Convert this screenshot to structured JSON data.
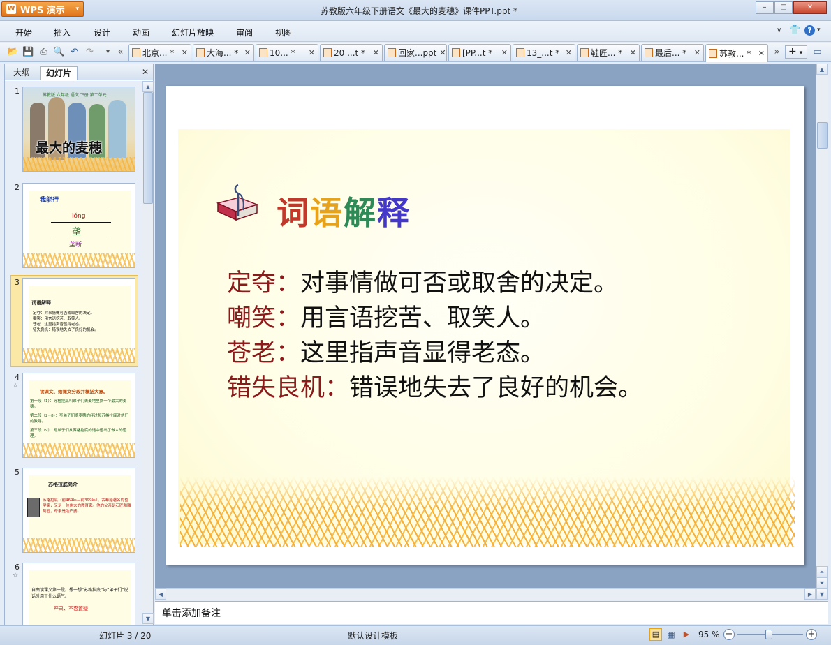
{
  "app": {
    "brand": "WPS 演示",
    "window_title": "苏教版六年级下册语文《最大的麦穗》课件PPT.ppt *",
    "win_controls": [
      "–",
      "□",
      "✕"
    ]
  },
  "menu": [
    "开始",
    "插入",
    "设计",
    "动画",
    "幻灯片放映",
    "审阅",
    "视图"
  ],
  "doc_tabs": [
    {
      "label": "北京... *"
    },
    {
      "label": "大海... *"
    },
    {
      "label": "10... *"
    },
    {
      "label": "20 ...t *"
    },
    {
      "label": "回家...ppt"
    },
    {
      "label": "[PP...t *"
    },
    {
      "label": "13_...t *"
    },
    {
      "label": "鞋匠... *"
    },
    {
      "label": "最后... *"
    },
    {
      "label": "苏教... *"
    }
  ],
  "left_pane": {
    "tabs": [
      "大纲",
      "幻灯片"
    ],
    "close": "✕",
    "slides": [
      {
        "num": "1",
        "title": "最大的麦穗",
        "sub": "苏教版 六年级 语文 下册 第二单元"
      },
      {
        "num": "2",
        "title": "我能行",
        "line1": "lǒng",
        "line2": "垄",
        "line3": "垄断"
      },
      {
        "num": "3",
        "title": "词语解释",
        "l1": "定夺：对事情做可否或取舍的决定。",
        "l2": "嘲笑：用言语挖苦、取笑人。",
        "l3": "苍老：这里指声音显得老态。",
        "l4": "错失良机：错误地失去了良好的机会。"
      },
      {
        "num": "4",
        "title": "读课文、给课文分段并概括大意。",
        "l1": "第一段（1）：苏格拉底叫弟子们去麦地里摘一个最大的麦穗。",
        "l2": "第二段（2~8）：写弟子们摘麦穗的经过和苏格拉底对他们的教导。",
        "l3": "第三段（9）：写弟子们从苏格拉底的话中悟出了做人的道理。"
      },
      {
        "num": "5",
        "title": "苏格拉底简介",
        "l1": "苏格拉底（前469年—前399年），古希腊著名的哲学家，又是一位伟大的教育家。他的父亲是石匠和雕刻匠，母亲是助产婆。"
      },
      {
        "num": "6",
        "l1": "自由读课文第一段。想一想“苏格拉底”与“弟子们”说话时用了什么语气。",
        "l2": "严肃、不容置疑"
      }
    ]
  },
  "slide": {
    "title_chars": [
      "词",
      "语",
      "解",
      "释"
    ],
    "definitions": [
      {
        "term": "定夺：",
        "text": "对事情做可否或取舍的决定。"
      },
      {
        "term": "嘲笑：",
        "text": "用言语挖苦、取笑人。"
      },
      {
        "term": "苍老：",
        "text": "这里指声音显得老态。"
      },
      {
        "term": "错失良机：",
        "text": "错误地失去了良好的机会。"
      }
    ]
  },
  "notes_placeholder": "单击添加备注",
  "status": {
    "slide_pos": "幻灯片 3 / 20",
    "template": "默认设计模板",
    "zoom": "95 %"
  },
  "colors": {
    "term": "#8b1a1a",
    "title_gradient": [
      "#c0392b",
      "#e6a21a",
      "#2e8b57",
      "#3d3dc8"
    ]
  }
}
